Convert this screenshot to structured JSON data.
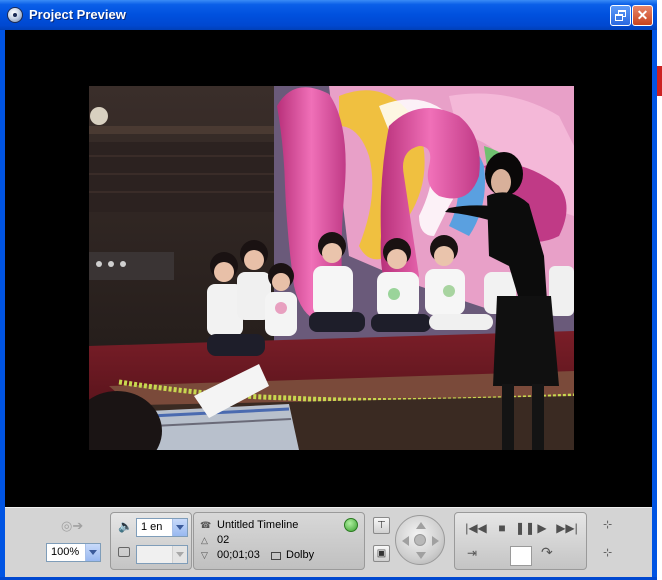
{
  "window": {
    "title": "Project Preview"
  },
  "controls": {
    "zoom_value": "100%",
    "audio_track_value": "1 en",
    "subtitle_value": "",
    "timeline_name": "Untitled Timeline",
    "chapter": "02",
    "timecode": "00;01;03",
    "audio_format": "Dolby"
  },
  "colors": {
    "titlebar": "#0054e3",
    "controlbar": "#d4d4d4",
    "close_button": "#c8431d"
  },
  "icons": {
    "app": "disc-icon",
    "restore": "restore-icon",
    "close": "close-icon",
    "audio": "speaker-icon",
    "subtitle": "subtitle-icon",
    "angle": "angle-icon",
    "globe": "globe-icon",
    "dolby": "dolby-icon"
  }
}
